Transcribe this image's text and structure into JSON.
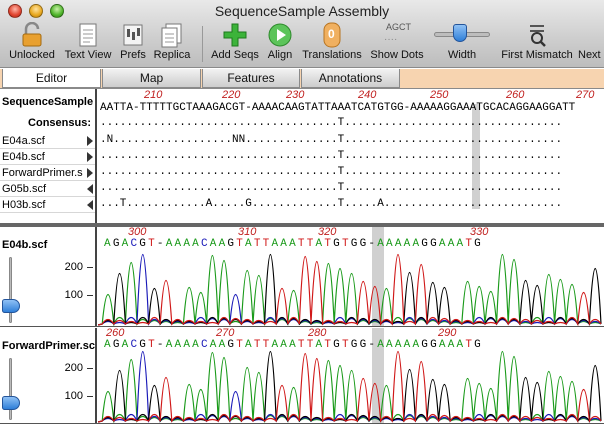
{
  "window": {
    "title": "SequenceSample Assembly"
  },
  "toolbar": {
    "items": [
      {
        "label": "Unlocked",
        "icon": "padlock-icon"
      },
      {
        "label": "Text View",
        "icon": "document-icon"
      },
      {
        "label": "Prefs",
        "icon": "prefs-icon"
      },
      {
        "label": "Replica",
        "icon": "replica-icon"
      },
      {
        "label": "Add Seqs",
        "icon": "plus-icon"
      },
      {
        "label": "Align",
        "icon": "play-icon"
      },
      {
        "label": "Translations",
        "icon": "translations-icon"
      },
      {
        "label": "Show Dots",
        "icon": "show-dots-icon"
      },
      {
        "label": "Width",
        "icon": "width-slider-icon"
      },
      {
        "label": "First Mismatch",
        "icon": "first-mismatch-icon"
      },
      {
        "label": "Next",
        "icon": "next-icon"
      }
    ],
    "show_dots_top": "AGCT",
    "translations_glyph": "0"
  },
  "tabs": [
    {
      "label": "Editor",
      "active": true
    },
    {
      "label": "Map",
      "active": false
    },
    {
      "label": "Features",
      "active": false
    },
    {
      "label": "Annotations",
      "active": false
    }
  ],
  "alignment": {
    "ruler_numbers": [
      "210",
      "220",
      "230",
      "240",
      "250",
      "260",
      "270"
    ],
    "reference_name": "SequenceSample",
    "reference_seq": "AATTA-TTTTTGCTAAAGACGT-AAAACAAGTATTAAATCATGTGG-AAAAAGGAAATGCACAGGAAGGATT",
    "consensus_label": "Consensus:",
    "consensus_seq": "....................................T.................................",
    "reads": [
      {
        "name": "E04a.scf",
        "dir": "r",
        "seq": ".N..................NN..............T................................."
      },
      {
        "name": "E04b.scf",
        "dir": "r",
        "seq": "....................................T................................."
      },
      {
        "name": "ForwardPrimer.s",
        "dir": "r",
        "seq": "....................................T................................."
      },
      {
        "name": "G05b.scf",
        "dir": "l",
        "seq": "....................................T................................."
      },
      {
        "name": "H03b.scf",
        "dir": "l",
        "seq": "...T............A.....G.............T.....A..........................."
      }
    ]
  },
  "traces": [
    {
      "name": "E04b.scf",
      "ruler_numbers": [
        "300",
        "310",
        "320",
        "330"
      ],
      "bases": "AGACGT-AAAACAAGTATTAAATTATGTGG-AAAAAGGAAATG",
      "y_labels": [
        "200",
        "100"
      ]
    },
    {
      "name": "ForwardPrimer.sc",
      "ruler_numbers": [
        "260",
        "270",
        "280",
        "290"
      ],
      "bases": "AGACGT-AAAACAAGTATTAAATTATGTGG-AAAAAGGAAATG",
      "y_labels": [
        "200",
        "100"
      ]
    }
  ],
  "colors": {
    "A": "#1a9a1a",
    "C": "#1a1ab8",
    "G": "#000000",
    "T": "#d01818",
    "ruler": "#c0201f",
    "tab_bar": "#f7d4b0",
    "highlight": "#d0d0d0"
  }
}
